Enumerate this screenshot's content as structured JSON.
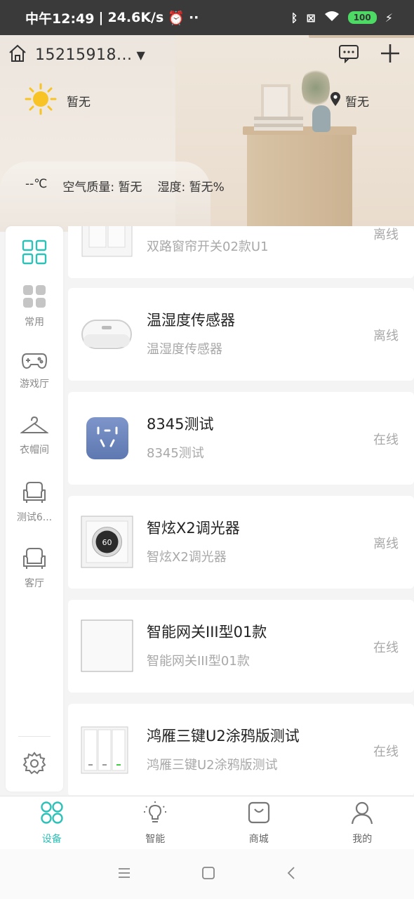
{
  "status_bar": {
    "time": "中午12:49",
    "speed": "24.6K/s",
    "battery": "100"
  },
  "header": {
    "home_name": "15215918...",
    "caret": "▼"
  },
  "weather": {
    "condition": "暂无",
    "location": "暂无",
    "temperature": "--℃",
    "air_quality": "空气质量: 暂无",
    "humidity": "湿度: 暂无%"
  },
  "sidebar": {
    "items": [
      {
        "label": ""
      },
      {
        "label": "常用"
      },
      {
        "label": "游戏厅"
      },
      {
        "label": "衣帽间"
      },
      {
        "label": "测试6..."
      },
      {
        "label": "客厅"
      }
    ]
  },
  "devices": [
    {
      "name": "",
      "sub": "双路窗帘开关02款U1",
      "status": "离线",
      "thumb": "switch-2gang"
    },
    {
      "name": "温湿度传感器",
      "sub": "温湿度传感器",
      "status": "离线",
      "thumb": "sensor"
    },
    {
      "name": "8345测试",
      "sub": "8345测试",
      "status": "在线",
      "thumb": "socket"
    },
    {
      "name": "智炫X2调光器",
      "sub": "智炫X2调光器",
      "status": "离线",
      "thumb": "dimmer",
      "dimmer_value": "60"
    },
    {
      "name": "智能网关III型01款",
      "sub": "智能网关III型01款",
      "status": "在线",
      "thumb": "panel"
    },
    {
      "name": "鸿雁三键U2涂鸦版测试",
      "sub": "鸿雁三键U2涂鸦版测试",
      "status": "在线",
      "thumb": "switch-3gang"
    }
  ],
  "bottom_nav": {
    "tabs": [
      {
        "label": "设备",
        "active": true
      },
      {
        "label": "智能"
      },
      {
        "label": "商城"
      },
      {
        "label": "我的"
      }
    ]
  },
  "colors": {
    "accent": "#2ec1b8",
    "muted": "#a8a8a8"
  }
}
